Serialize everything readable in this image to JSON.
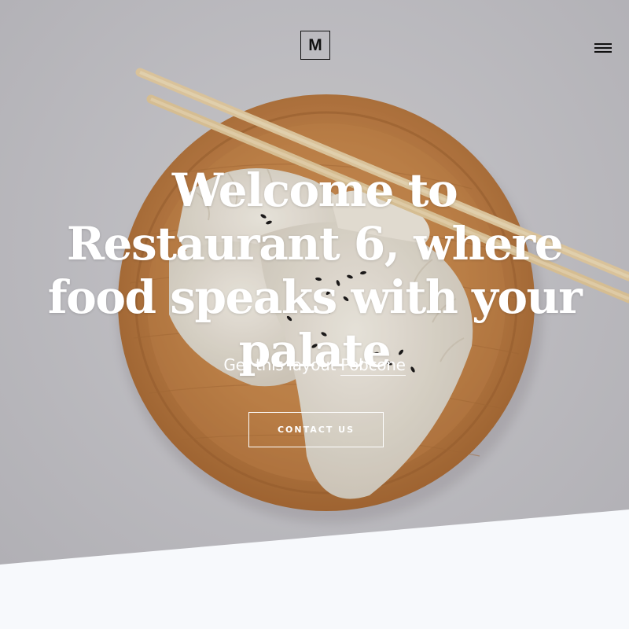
{
  "header": {
    "logo_text": "M",
    "menu_icon": "hamburger-menu-icon"
  },
  "hero": {
    "headline": "Welcome to Restaurant 6, where food speaks with your palate",
    "subline_prefix": "Get this layout",
    "subline_link": "Pobcone",
    "cta_label": "CONTACT US",
    "image": "dumplings-plate-chopsticks-photo"
  },
  "colors": {
    "hero_background": "#c8c7cb",
    "plate_wood": "#c98a4e",
    "text": "#ffffff",
    "bottom_band": "#f7f9fc"
  }
}
